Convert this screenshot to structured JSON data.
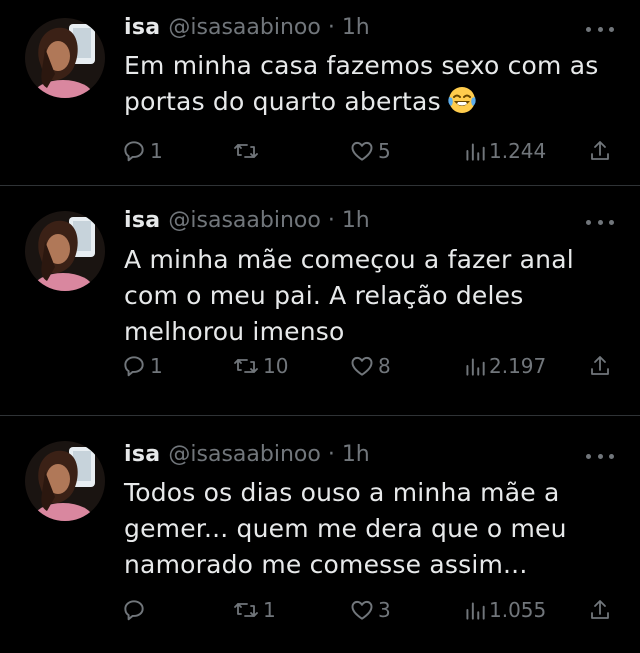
{
  "tweets": [
    {
      "name": "isa",
      "handle": "@isasaabinoo",
      "separator": "·",
      "time": "1h",
      "text": "Em minha casa fazemos sexo com as\nportas do quarto abertas",
      "emoji": "face-with-tears-of-joy",
      "replies": "1",
      "retweets": "",
      "likes": "5",
      "views": "1.244"
    },
    {
      "name": "isa",
      "handle": "@isasaabinoo",
      "separator": "·",
      "time": "1h",
      "text": "A minha mãe começou a fazer anal\ncom o meu pai. A relação deles\nmelhorou imenso",
      "replies": "1",
      "retweets": "10",
      "likes": "8",
      "views": "2.197"
    },
    {
      "name": "isa",
      "handle": "@isasaabinoo",
      "separator": "·",
      "time": "1h",
      "text": "Todos os dias ouso a minha mãe a\ngemer... quem me dera que o meu\nnamorado me comesse assim...",
      "replies": "",
      "retweets": "1",
      "likes": "3",
      "views": "1.055"
    }
  ],
  "icons": {
    "reply": "reply-icon",
    "retweet": "retweet-icon",
    "like": "heart-icon",
    "views": "views-chart-icon",
    "share": "share-icon",
    "more": "more-dots-icon"
  },
  "colors": {
    "background": "#000000",
    "text": "#e7e9ea",
    "secondary": "#71767b",
    "divider": "#2f3336"
  }
}
